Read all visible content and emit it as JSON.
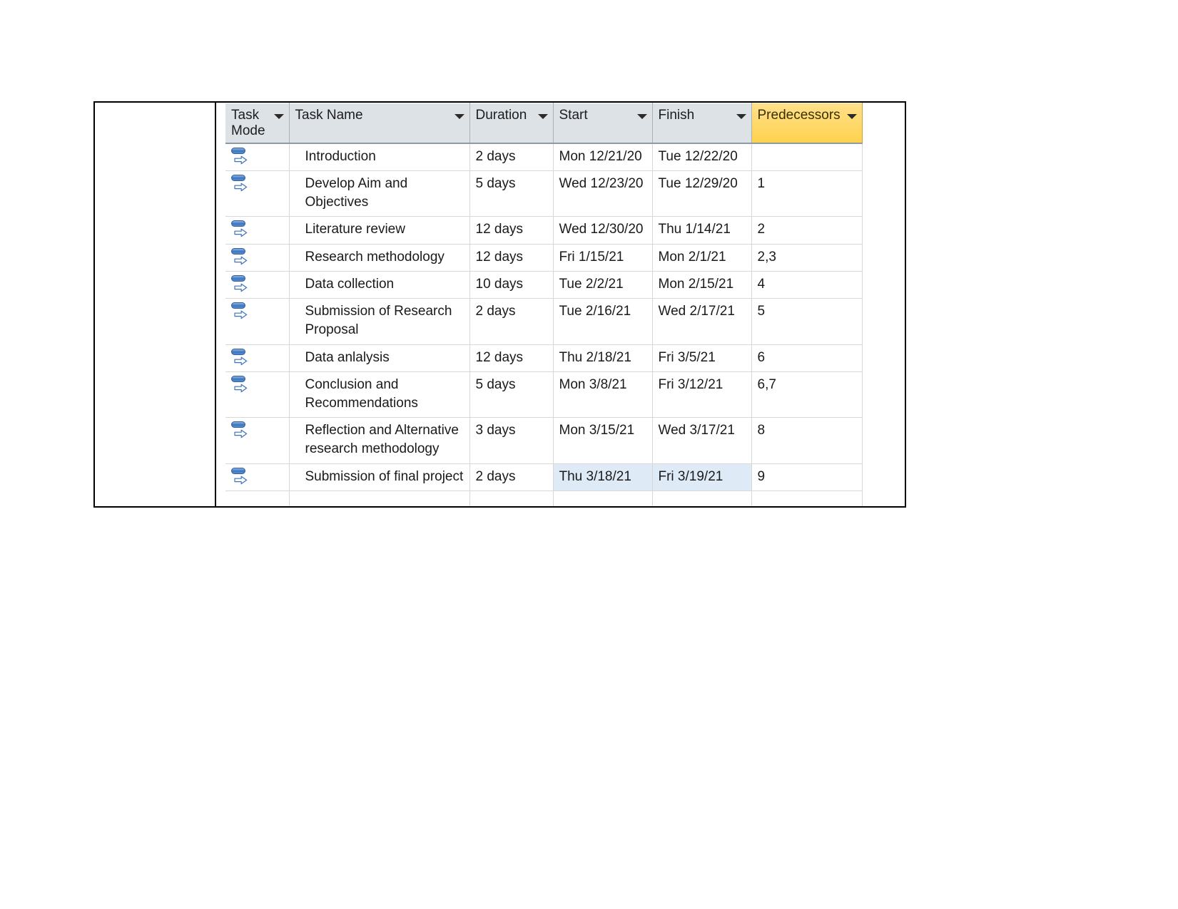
{
  "table": {
    "columns": [
      {
        "key": "mode",
        "label": "Task Mode",
        "highlight": false,
        "icon": "chevron-down-icon"
      },
      {
        "key": "name",
        "label": "Task Name",
        "highlight": false,
        "icon": "chevron-down-icon"
      },
      {
        "key": "dur",
        "label": "Duration",
        "highlight": false,
        "icon": "chevron-down-icon"
      },
      {
        "key": "start",
        "label": "Start",
        "highlight": false,
        "icon": "chevron-down-icon"
      },
      {
        "key": "finish",
        "label": "Finish",
        "highlight": false,
        "icon": "chevron-down-icon"
      },
      {
        "key": "pred",
        "label": "Predecessors",
        "highlight": true,
        "icon": "chevron-down-icon"
      }
    ],
    "header_highlight_color": "#ffd24d",
    "selection_color": "#dfeaf7",
    "rows": [
      {
        "mode_icon": "auto-scheduled-icon",
        "name": "Introduction",
        "duration": "2 days",
        "start": "Mon 12/21/20",
        "finish": "Tue 12/22/20",
        "predecessors": "",
        "selected": false
      },
      {
        "mode_icon": "auto-scheduled-icon",
        "name": "Develop Aim and Objectives",
        "duration": "5 days",
        "start": "Wed 12/23/20",
        "finish": "Tue 12/29/20",
        "predecessors": "1",
        "selected": false
      },
      {
        "mode_icon": "auto-scheduled-icon",
        "name": "Literature review",
        "duration": "12 days",
        "start": "Wed 12/30/20",
        "finish": "Thu 1/14/21",
        "predecessors": "2",
        "selected": false
      },
      {
        "mode_icon": "auto-scheduled-icon",
        "name": "Research methodology",
        "duration": "12 days",
        "start": "Fri 1/15/21",
        "finish": "Mon 2/1/21",
        "predecessors": "2,3",
        "selected": false
      },
      {
        "mode_icon": "auto-scheduled-icon",
        "name": "Data collection",
        "duration": "10 days",
        "start": "Tue 2/2/21",
        "finish": "Mon 2/15/21",
        "predecessors": "4",
        "selected": false
      },
      {
        "mode_icon": "auto-scheduled-icon",
        "name": "Submission of Research Proposal",
        "duration": "2 days",
        "start": "Tue 2/16/21",
        "finish": "Wed 2/17/21",
        "predecessors": "5",
        "selected": false
      },
      {
        "mode_icon": "auto-scheduled-icon",
        "name": "Data anlalysis",
        "duration": "12 days",
        "start": "Thu 2/18/21",
        "finish": "Fri 3/5/21",
        "predecessors": "6",
        "selected": false
      },
      {
        "mode_icon": "auto-scheduled-icon",
        "name": "Conclusion and Recommendations",
        "duration": "5 days",
        "start": "Mon 3/8/21",
        "finish": "Fri 3/12/21",
        "predecessors": "6,7",
        "selected": false
      },
      {
        "mode_icon": "auto-scheduled-icon",
        "name": "Reflection and Alternative research methodology",
        "duration": "3 days",
        "start": "Mon 3/15/21",
        "finish": "Wed 3/17/21",
        "predecessors": "8",
        "selected": false
      },
      {
        "mode_icon": "auto-scheduled-icon",
        "name": "Submission of final project",
        "duration": "2 days",
        "start": "Thu 3/18/21",
        "finish": "Fri 3/19/21",
        "predecessors": "9",
        "selected": true
      }
    ]
  }
}
